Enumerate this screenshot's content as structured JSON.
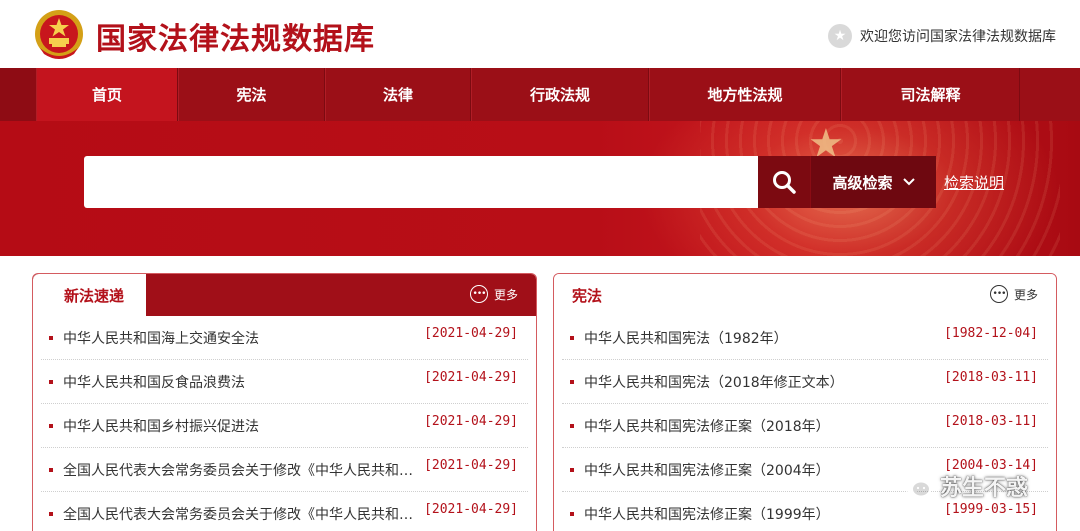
{
  "header": {
    "site_title": "国家法律法规数据库",
    "welcome_text": "欢迎您访问国家法律法规数据库",
    "emblem_icon": "national-emblem",
    "welcome_icon": "star-circle-icon"
  },
  "nav": {
    "items": [
      {
        "label": "首页"
      },
      {
        "label": "宪法"
      },
      {
        "label": "法律"
      },
      {
        "label": "行政法规"
      },
      {
        "label": "地方性法规"
      },
      {
        "label": "司法解释"
      }
    ],
    "active_index": 0
  },
  "search": {
    "input_value": "",
    "placeholder": "",
    "advanced_label": "高级检索",
    "help_label": "检索说明"
  },
  "panels": {
    "new_laws": {
      "title": "新法速递",
      "more_label": "更多",
      "items": [
        {
          "title": "中华人民共和国海上交通安全法",
          "date": "[2021-04-29]"
        },
        {
          "title": "中华人民共和国反食品浪费法",
          "date": "[2021-04-29]"
        },
        {
          "title": "中华人民共和国乡村振兴促进法",
          "date": "[2021-04-29]"
        },
        {
          "title": "全国人民代表大会常务委员会关于修改《中华人民共和…",
          "date": "[2021-04-29]"
        },
        {
          "title": "全国人民代表大会常务委员会关于修改《中华人民共和…",
          "date": "[2021-04-29]"
        }
      ]
    },
    "constitution": {
      "title": "宪法",
      "more_label": "更多",
      "items": [
        {
          "title": "中华人民共和国宪法（1982年）",
          "date": "[1982-12-04]"
        },
        {
          "title": "中华人民共和国宪法（2018年修正文本）",
          "date": "[2018-03-11]"
        },
        {
          "title": "中华人民共和国宪法修正案（2018年）",
          "date": "[2018-03-11]"
        },
        {
          "title": "中华人民共和国宪法修正案（2004年）",
          "date": "[2004-03-14]"
        },
        {
          "title": "中华人民共和国宪法修正案（1999年）",
          "date": "[1999-03-15]"
        }
      ]
    }
  },
  "watermark": {
    "text": "苏生不惑",
    "icon": "wechat-icon"
  },
  "colors": {
    "brand_red": "#b3111a",
    "nav_bg": "#9b0f17",
    "nav_active": "#c4141e",
    "search_btn": "#7c0a11"
  }
}
